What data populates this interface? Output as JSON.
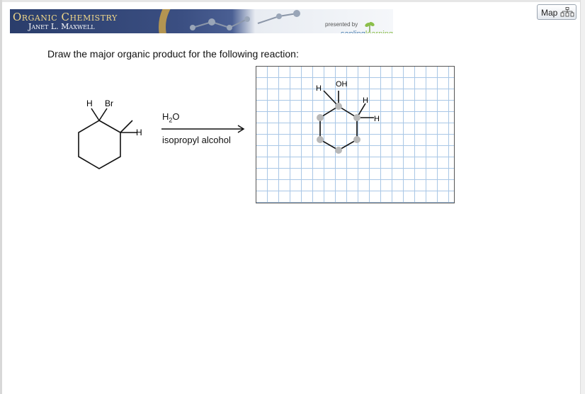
{
  "banner": {
    "title": "Organic Chemistry",
    "author": "Janet L. Maxwell",
    "presented_by": "presented by",
    "brand_part1": "sapling",
    "brand_part2": "learning"
  },
  "map_button": {
    "label": "Map",
    "icon": "sitemap-icon"
  },
  "question": {
    "text": "Draw the major organic product for the following reaction:"
  },
  "reactant": {
    "label_h": "H",
    "label_br": "Br",
    "label_h2": "H"
  },
  "reagents": {
    "line1_main": "H",
    "line1_sub": "2",
    "line1_end": "O",
    "line2": "isopropyl alcohol"
  },
  "product": {
    "label_h1": "H",
    "label_oh": "OH",
    "label_h2": "H",
    "label_h3": "H"
  },
  "colors": {
    "banner_dark": "#2a3d6b",
    "banner_gold": "#f3d98a",
    "grid": "#a9c7e6",
    "atom_dot": "#b8b8b8"
  }
}
